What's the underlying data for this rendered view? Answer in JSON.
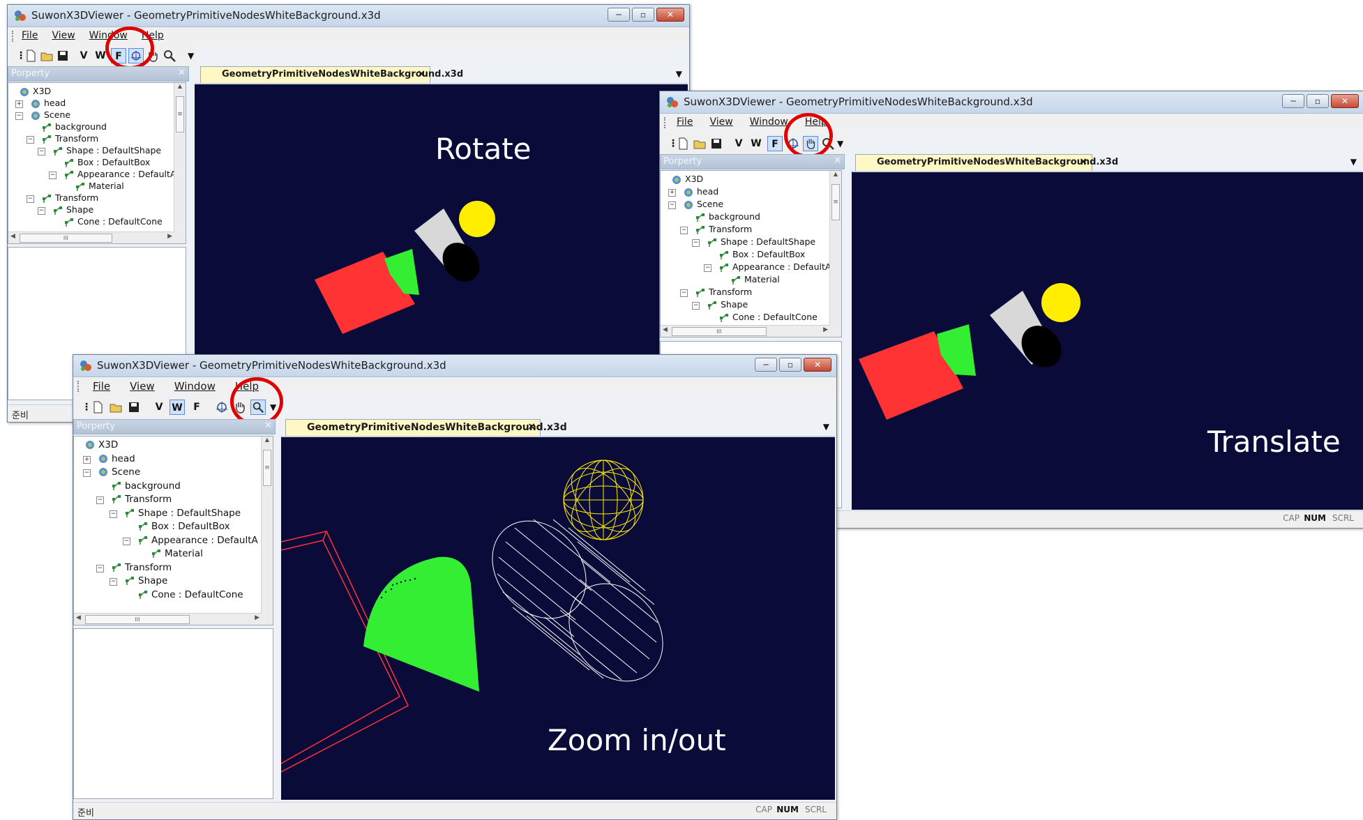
{
  "app": {
    "title": "SuwonX3DViewer - GeometryPrimitiveNodesWhiteBackground.x3d",
    "doc_tab": "GeometryPrimitiveNodesWhiteBackground.x3d"
  },
  "menu": [
    "File",
    "View",
    "Window",
    "Help"
  ],
  "toolbar": {
    "v_label": "V",
    "w_label": "W",
    "f_label": "F"
  },
  "window_buttons": {
    "minimize": "─",
    "maximize": "▫",
    "close": "✕"
  },
  "panel": {
    "title": "Porperty",
    "pin": "ᵖ",
    "close": "✕"
  },
  "tree": [
    {
      "label": "X3D",
      "icon": "globe-icon",
      "indent": 0,
      "toggle": ""
    },
    {
      "label": "head",
      "icon": "globe-icon",
      "indent": 1,
      "toggle": "+"
    },
    {
      "label": "Scene",
      "icon": "globe-icon",
      "indent": 1,
      "toggle": "−"
    },
    {
      "label": "background",
      "icon": "node-icon",
      "indent": 2,
      "toggle": ""
    },
    {
      "label": "Transform",
      "icon": "node-icon",
      "indent": 2,
      "toggle": "−"
    },
    {
      "label": "Shape : DefaultShape",
      "icon": "node-icon",
      "indent": 3,
      "toggle": "−"
    },
    {
      "label": "Box : DefaultBox",
      "icon": "node-icon",
      "indent": 4,
      "toggle": ""
    },
    {
      "label": "Appearance : DefaultA",
      "icon": "node-icon",
      "indent": 4,
      "toggle": "−"
    },
    {
      "label": "Material",
      "icon": "node-icon",
      "indent": 5,
      "toggle": ""
    },
    {
      "label": "Transform",
      "icon": "node-icon",
      "indent": 2,
      "toggle": "−"
    },
    {
      "label": "Shape",
      "icon": "node-icon",
      "indent": 3,
      "toggle": "−"
    },
    {
      "label": "Cone : DefaultCone",
      "icon": "node-icon",
      "indent": 4,
      "toggle": ""
    }
  ],
  "scrollbar": {
    "h_grip": "III",
    "v_grip": "≡",
    "up": "▲",
    "down": "▼",
    "left": "◀",
    "right": "▶"
  },
  "viewport_labels": {
    "rotate": "Rotate",
    "translate": "Translate",
    "zoom": "Zoom in/out"
  },
  "status": {
    "text": "준비",
    "cap": "CAP",
    "num": "NUM",
    "scrl": "SCRL"
  },
  "tab_dropdown": "▼",
  "colors": {
    "viewport_bg": "#0b0b3a",
    "box": "#ff3333",
    "cone": "#33ee33",
    "cylinder": "#d8d8d8",
    "sphere": "#ffee00",
    "highlight_circle": "#e00000"
  }
}
